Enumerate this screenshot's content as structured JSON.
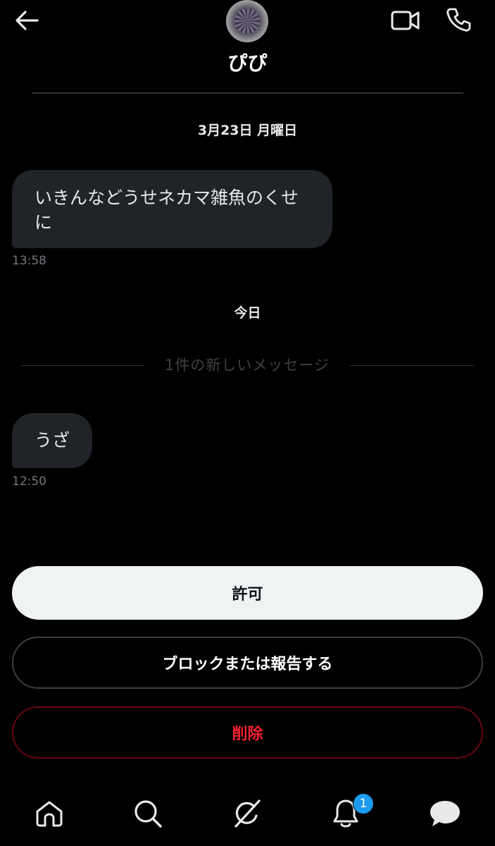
{
  "header": {
    "name": "ぴぴ",
    "icons": {
      "back": "arrow-left-icon",
      "video": "video-camera-icon",
      "call": "phone-icon"
    }
  },
  "conversation": {
    "date_first": "3月23日 月曜日",
    "message_first": {
      "text": "いきんなどうせネカマ雑魚のくせに",
      "time": "13:58"
    },
    "date_second": "今日",
    "new_messages_separator": "1件の新しいメッセージ",
    "message_second": {
      "text": "うざ",
      "time": "12:50"
    }
  },
  "actions": {
    "allow_label": "許可",
    "block_label": "ブロックまたは報告する",
    "delete_label": "削除"
  },
  "nav": {
    "icons": [
      "home-icon",
      "search-icon",
      "grok-icon",
      "bell-icon",
      "messages-icon"
    ],
    "notification_count": "1"
  },
  "colors": {
    "background": "#000000",
    "bubble": "#202327",
    "accent": "#1d9bf0",
    "danger": "#f4212e"
  }
}
